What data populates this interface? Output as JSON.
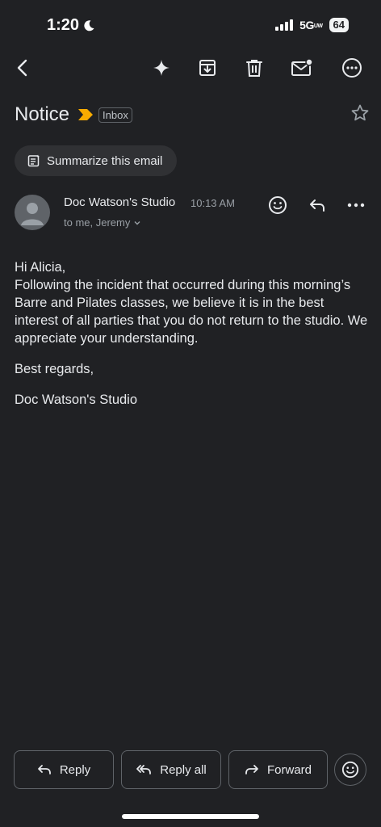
{
  "status_bar": {
    "time": "1:20",
    "network": "5G",
    "network_suffix": "UW",
    "battery": "64"
  },
  "toolbar": {
    "icons": [
      "back-icon",
      "sparkle-icon",
      "archive-icon",
      "delete-icon",
      "mark-unread-icon",
      "more-icon"
    ]
  },
  "email": {
    "subject": "Notice",
    "label": "Inbox",
    "summarize_label": "Summarize this email",
    "sender": "Doc Watson's Studio",
    "time": "10:13 AM",
    "recipients": "to me, Jeremy",
    "body": {
      "greeting": "Hi Alicia,",
      "paragraph": "Following the incident that occurred during this morning’s Barre and Pilates classes, we believe it is in the best interest of all parties that you do not return to the studio. We appreciate your understanding.",
      "closing": "Best regards,",
      "signature": "Doc Watson's Studio"
    }
  },
  "actions": {
    "reply": "Reply",
    "reply_all": "Reply all",
    "forward": "Forward"
  },
  "colors": {
    "background": "#202124",
    "importance": "#f9ab00",
    "chip": "#303134"
  }
}
